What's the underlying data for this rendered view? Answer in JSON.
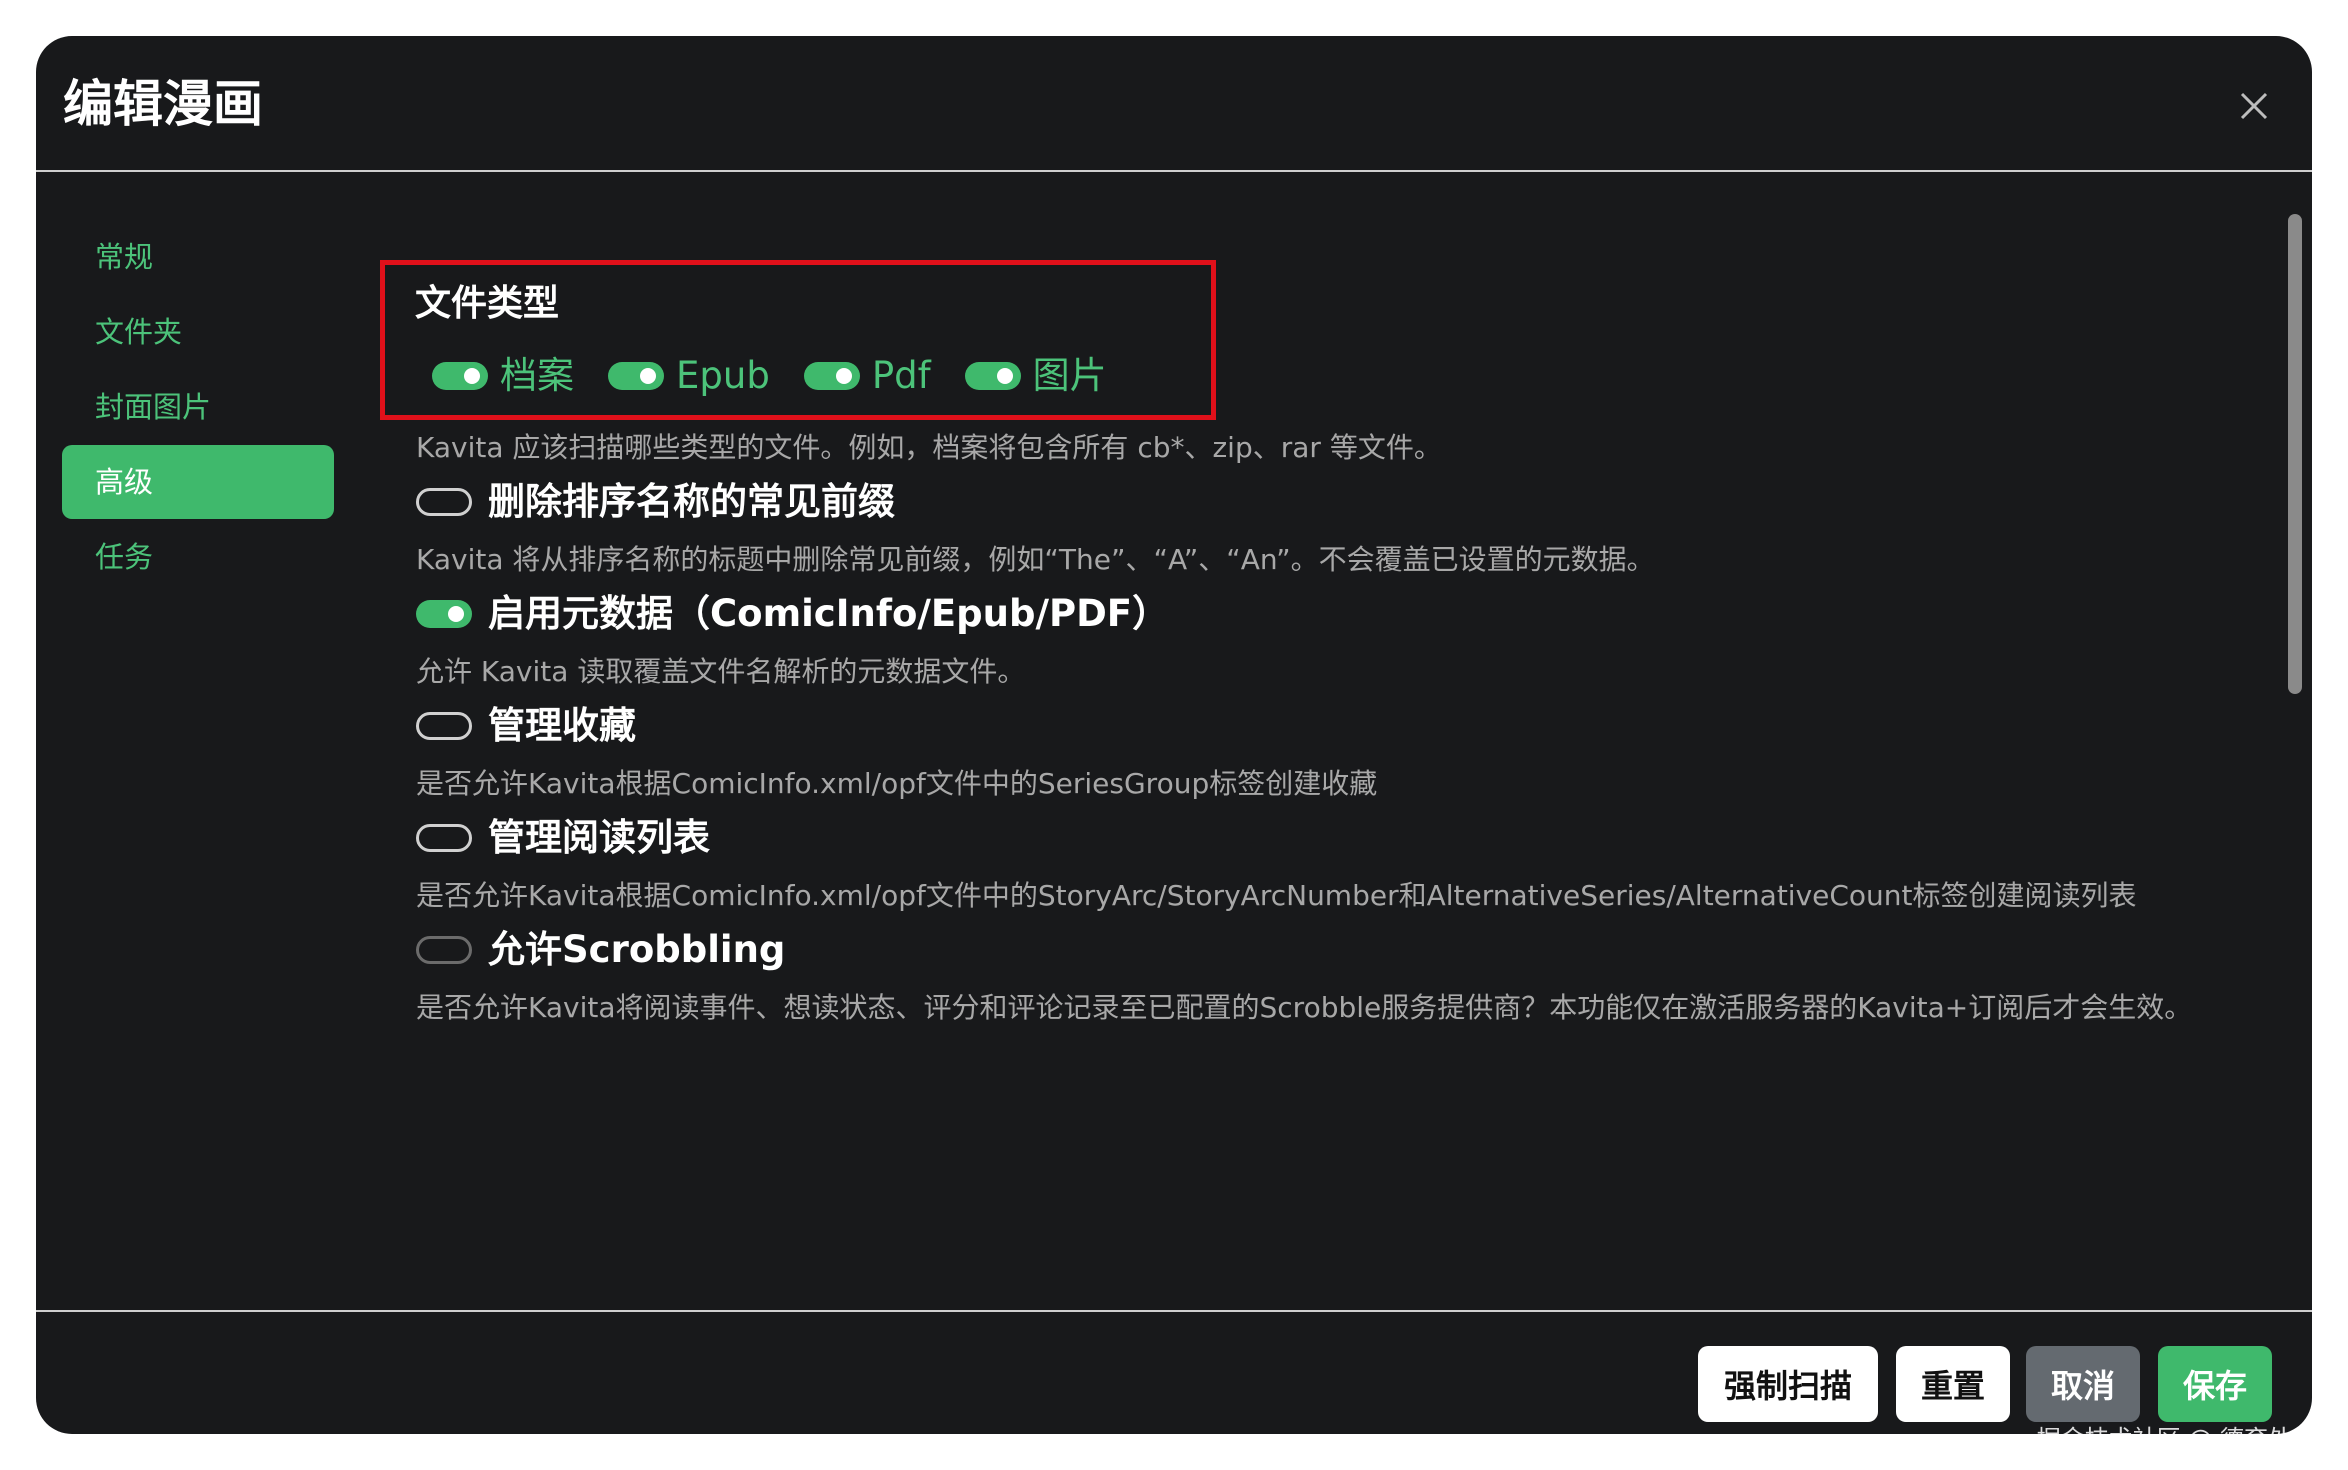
{
  "header": {
    "title": "编辑漫画"
  },
  "sidebar": {
    "items": [
      {
        "label": "常规",
        "active": false
      },
      {
        "label": "文件夹",
        "active": false
      },
      {
        "label": "封面图片",
        "active": false
      },
      {
        "label": "高级",
        "active": true
      },
      {
        "label": "任务",
        "active": false
      }
    ]
  },
  "file_types": {
    "title": "文件类型",
    "items": [
      {
        "label": "档案",
        "enabled": true
      },
      {
        "label": "Epub",
        "enabled": true
      },
      {
        "label": "Pdf",
        "enabled": true
      },
      {
        "label": "图片",
        "enabled": true
      }
    ],
    "help": "Kavita 应该扫描哪些类型的文件。例如，档案将包含所有 cb*、zip、rar 等文件。"
  },
  "settings": [
    {
      "label": "删除排序名称的常见前缀",
      "enabled": false,
      "help": "Kavita 将从排序名称的标题中删除常见前缀，例如“The”、“A”、“An”。不会覆盖已设置的元数据。"
    },
    {
      "label": "启用元数据（ComicInfo/Epub/PDF）",
      "enabled": true,
      "help": "允许 Kavita 读取覆盖文件名解析的元数据文件。"
    },
    {
      "label": "管理收藏",
      "enabled": false,
      "help": "是否允许Kavita根据ComicInfo.xml/opf文件中的SeriesGroup标签创建收藏"
    },
    {
      "label": "管理阅读列表",
      "enabled": false,
      "help": "是否允许Kavita根据ComicInfo.xml/opf文件中的StoryArc/StoryArcNumber和AlternativeSeries/AlternativeCount标签创建阅读列表"
    },
    {
      "label": "允许Scrobbling",
      "enabled": false,
      "help": "是否允许Kavita将阅读事件、想读状态、评分和评论记录至已配置的Scrobble服务提供商？本功能仅在激活服务器的Kavita+订阅后才会生效。"
    }
  ],
  "footer": {
    "scan_label": "强制扫描",
    "reset_label": "重置",
    "cancel_label": "取消",
    "save_label": "保存"
  },
  "watermark": "掘金技术社区 @ 德育处主任",
  "colors": {
    "accent": "#3fb96c",
    "highlight": "#e0101a",
    "background": "#18191b"
  }
}
